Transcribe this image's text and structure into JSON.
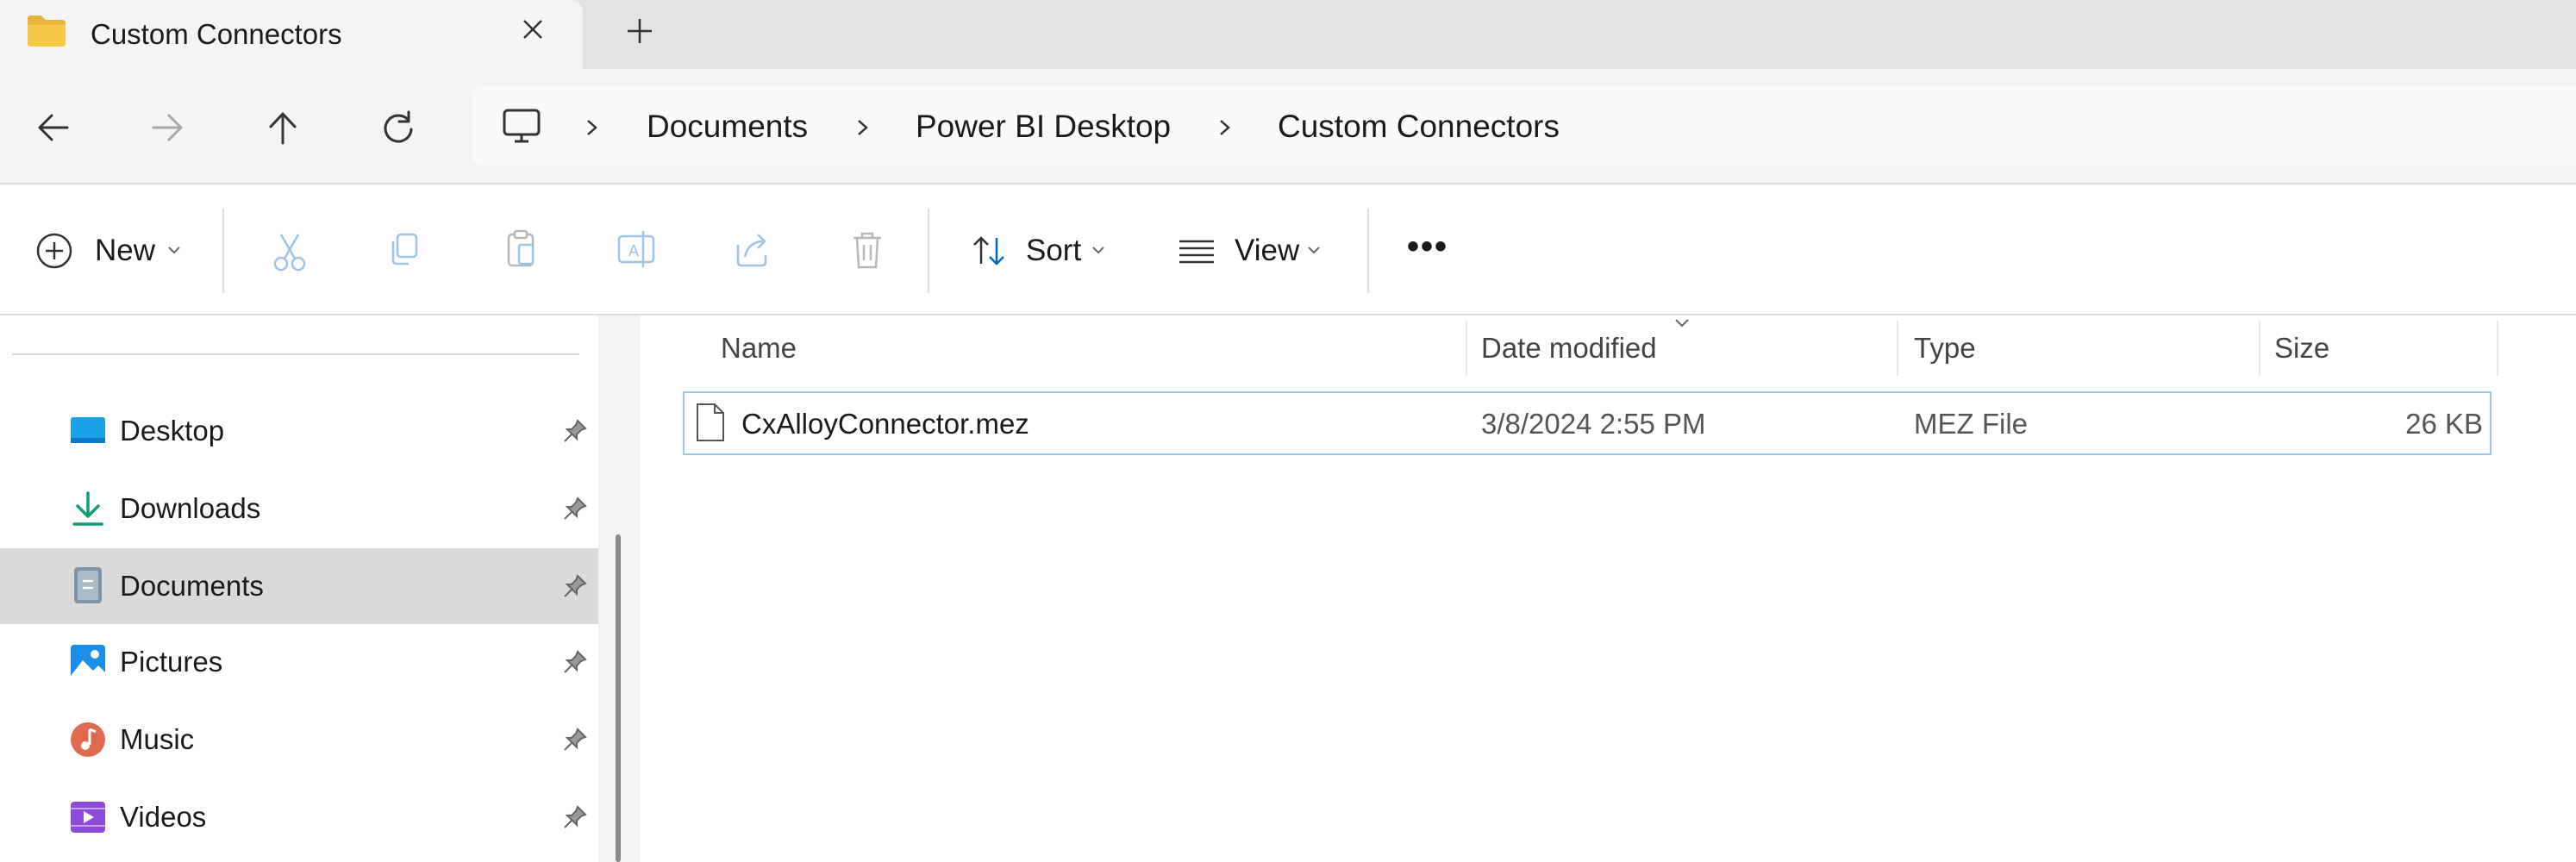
{
  "window": {
    "tab_title": "Custom Connectors",
    "close_tab_symbol": "✕",
    "new_tab_symbol": "+"
  },
  "navigation": {
    "back_icon": "arrow-left-icon",
    "forward_icon": "arrow-right-icon",
    "up_icon": "arrow-up-icon",
    "refresh_icon": "refresh-icon"
  },
  "address_bar": {
    "root_icon": "this-pc-icon",
    "breadcrumbs": [
      "Documents",
      "Power BI Desktop",
      "Custom Connectors"
    ]
  },
  "command_bar": {
    "new_label": "New",
    "sort_label": "Sort",
    "view_label": "View",
    "more_symbol": "•••"
  },
  "nav_pane": {
    "items": [
      {
        "label": "Desktop",
        "icon": "desktop-icon",
        "pinned": true
      },
      {
        "label": "Downloads",
        "icon": "download-icon",
        "pinned": true
      },
      {
        "label": "Documents",
        "icon": "documents-icon",
        "pinned": true,
        "selected": true
      },
      {
        "label": "Pictures",
        "icon": "pictures-icon",
        "pinned": true
      },
      {
        "label": "Music",
        "icon": "music-icon",
        "pinned": true
      },
      {
        "label": "Videos",
        "icon": "videos-icon",
        "pinned": true
      }
    ]
  },
  "file_list": {
    "columns": [
      "Name",
      "Date modified",
      "Type",
      "Size"
    ],
    "sorted_column": "Date modified",
    "rows": [
      {
        "name": "CxAlloyConnector.mez",
        "date_modified": "3/8/2024 2:55 PM",
        "type": "MEZ File",
        "size": "26 KB"
      }
    ]
  },
  "colors": {
    "accent": "#0067c0",
    "selection_border": "#99c9ef",
    "folder_yellow": "#f7c948"
  }
}
